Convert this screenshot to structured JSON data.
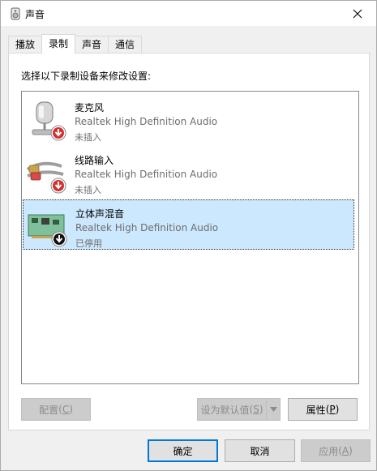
{
  "window": {
    "title": "声音"
  },
  "tabs": [
    {
      "label": "播放"
    },
    {
      "label": "录制"
    },
    {
      "label": "声音"
    },
    {
      "label": "通信"
    }
  ],
  "instructions": "选择以下录制设备来修改设置:",
  "devices": [
    {
      "name": "麦克风",
      "description": "Realtek High Definition Audio",
      "status": "未插入",
      "icon": "microphone-icon"
    },
    {
      "name": "线路输入",
      "description": "Realtek High Definition Audio",
      "status": "未插入",
      "icon": "line-in-cable-icon"
    },
    {
      "name": "立体声混音",
      "description": "Realtek High Definition Audio",
      "status": "已停用",
      "icon": "sound-card-icon"
    }
  ],
  "buttons": {
    "configure": {
      "text": "配置",
      "key": "C"
    },
    "set_default": {
      "text": "设为默认值",
      "key": "S"
    },
    "properties": {
      "text": "属性",
      "key": "P"
    },
    "ok": "确定",
    "cancel": "取消",
    "apply": {
      "text": "应用",
      "key": "A"
    }
  },
  "colors": {
    "selection": "#cce8ff",
    "accent": "#0078d7",
    "disabled_badge": "#d32f2f"
  }
}
